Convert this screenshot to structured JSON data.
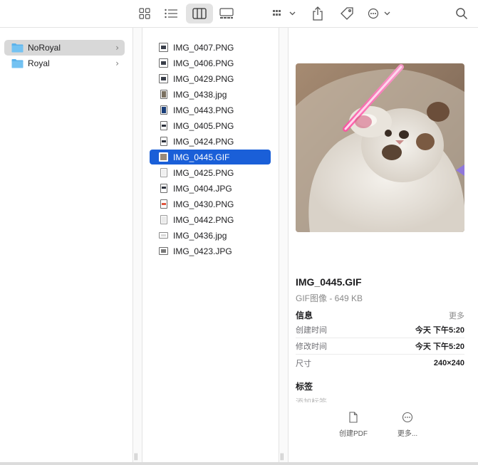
{
  "toolbar": {
    "view_buttons": [
      "grid-view",
      "list-view",
      "column-view",
      "gallery-view"
    ],
    "active_view": "column-view"
  },
  "sidebar": {
    "folders": [
      {
        "label": "NoRoyal",
        "selected": true
      },
      {
        "label": "Royal",
        "selected": false
      }
    ]
  },
  "files": [
    {
      "name": "IMG_0407.PNG"
    },
    {
      "name": "IMG_0406.PNG"
    },
    {
      "name": "IMG_0429.PNG"
    },
    {
      "name": "IMG_0438.jpg"
    },
    {
      "name": "IMG_0443.PNG"
    },
    {
      "name": "IMG_0405.PNG"
    },
    {
      "name": "IMG_0424.PNG"
    },
    {
      "name": "IMG_0445.GIF",
      "selected": true
    },
    {
      "name": "IMG_0425.PNG"
    },
    {
      "name": "IMG_0404.JPG"
    },
    {
      "name": "IMG_0430.PNG"
    },
    {
      "name": "IMG_0442.PNG"
    },
    {
      "name": "IMG_0436.jpg"
    },
    {
      "name": "IMG_0423.JPG"
    }
  ],
  "preview": {
    "filename": "IMG_0445.GIF",
    "kind_size": "GIF图像 - 649 KB",
    "info_heading": "信息",
    "more_label": "更多",
    "meta": [
      {
        "key": "创建时间",
        "value": "今天 下午5:20"
      },
      {
        "key": "修改时间",
        "value": "今天 下午5:20"
      },
      {
        "key": "尺寸",
        "value": "240×240"
      }
    ],
    "tags_heading": "标签",
    "add_tag_placeholder": "添加标签",
    "actions": [
      {
        "label": "创建PDF",
        "icon": "document-icon"
      },
      {
        "label": "更多...",
        "icon": "ellipsis-circle-icon"
      }
    ]
  },
  "colors": {
    "selection": "#1a5fd8",
    "folder": "#5bb2ea",
    "sidebar_selection": "#d8d8d8"
  }
}
